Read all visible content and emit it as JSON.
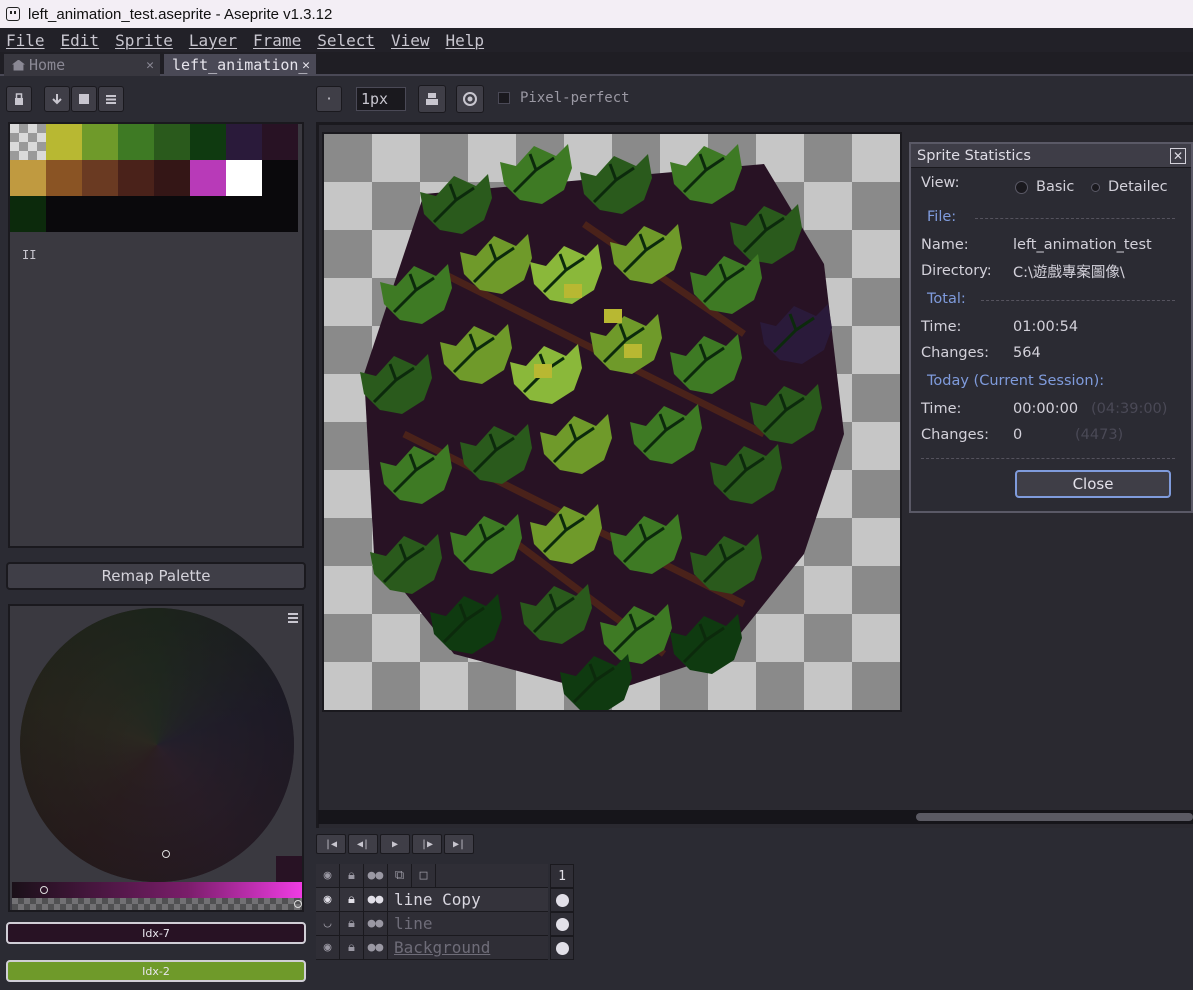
{
  "window": {
    "title": "left_animation_test.aseprite - Aseprite v1.3.12"
  },
  "menu": [
    "File",
    "Edit",
    "Sprite",
    "Layer",
    "Frame",
    "Select",
    "View",
    "Help"
  ],
  "tabs": {
    "home": "Home",
    "file": "left_animation_",
    "close": "✕"
  },
  "toolbar": {
    "brush_size": "1px",
    "pixel_perfect": "Pixel-perfect",
    "brush_dot": "·"
  },
  "palette": {
    "colors": [
      "#b8b832",
      "#6f9a2a",
      "#3e7a24",
      "#2a5a1c",
      "#0f3a10",
      "#2a1a3a",
      "#281224",
      "#c09a40",
      "#8a5424",
      "#6a3a22",
      "#4a221a",
      "#341616",
      "#b83ab8",
      "#ffffff",
      "#0a090c",
      "#0c2a0c"
    ],
    "info_glyph": "II"
  },
  "remap_button": "Remap Palette",
  "fg_color": {
    "label": "Idx-7",
    "color": "#281224"
  },
  "bg_color": {
    "label": "Idx-2",
    "color": "#6f9a2a"
  },
  "stats_dialog": {
    "title": "Sprite Statistics",
    "view_label": "View:",
    "view_basic": "Basic",
    "view_detailed": "Detailec",
    "file_section": "File:",
    "name_label": "Name:",
    "name_value": "left_animation_test",
    "dir_label": "Directory:",
    "dir_value": "C:\\遊戲專案圖像\\",
    "total_section": "Total:",
    "time_label": "Time:",
    "time_total": "01:00:54",
    "changes_label": "Changes:",
    "changes_total": "564",
    "today_section": "Today (Current Session):",
    "time_today": "00:00:00",
    "time_today_extra": "(04:39:00)",
    "changes_today": "0",
    "changes_today_extra": "(4473)",
    "close_button": "Close"
  },
  "timeline": {
    "frame_number": "1",
    "layers": [
      "line Copy",
      "line",
      "Background"
    ]
  }
}
